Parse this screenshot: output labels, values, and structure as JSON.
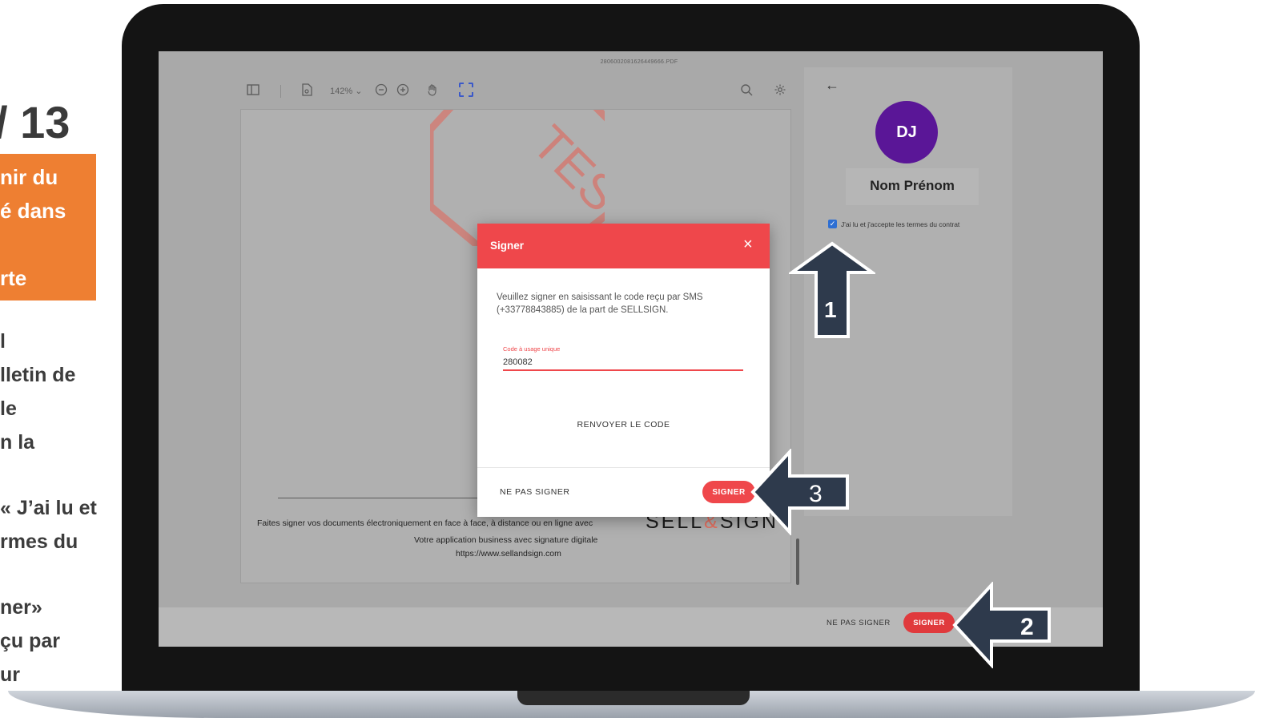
{
  "slide": {
    "page_number": "/ 13",
    "orange_lines": [
      "nir du",
      "é dans",
      "",
      "rte"
    ],
    "body_lines": [
      "l",
      "lletin de",
      " le",
      "n la",
      "",
      "« J’ai lu et",
      "rmes du",
      "",
      "ner»",
      "çu par",
      "ur"
    ]
  },
  "viewer": {
    "filename": "2806002081626449666.PDF",
    "zoom": "142% ⌄",
    "stamp_text": "TEST",
    "footer_line1": "Faites signer vos documents électroniquement en face à face, à distance ou en ligne avec",
    "footer_line2": "Votre application business avec signature digitale",
    "footer_line3": "https://www.sellandsign.com",
    "brand_part1": "SELL",
    "brand_amp": "&",
    "brand_part2": "SIGN"
  },
  "signer": {
    "initials": "DJ",
    "name": "Nom Prénom",
    "terms_label": "J'ai lu et j'accepte les termes du contrat",
    "terms_checked": true
  },
  "action_bar": {
    "decline_label": "NE PAS SIGNER",
    "sign_label": "SIGNER"
  },
  "modal": {
    "title": "Signer",
    "close": "×",
    "instruction": "Veuillez signer en saisissant le code reçu par SMS (+33778843885) de la part de SELLSIGN.",
    "otp_label": "Code à usage unique",
    "otp_value": "280082",
    "resend_label": "RENVOYER LE CODE",
    "decline_label": "NE PAS SIGNER",
    "sign_label": "SIGNER"
  },
  "annotations": [
    "1",
    "2",
    "3"
  ],
  "colors": {
    "accent_red": "#ef474b",
    "avatar_purple": "#5a1697",
    "slide_orange": "#ee7f32",
    "arrow_navy": "#2e3a4c",
    "checkbox_blue": "#2e6fd3"
  }
}
